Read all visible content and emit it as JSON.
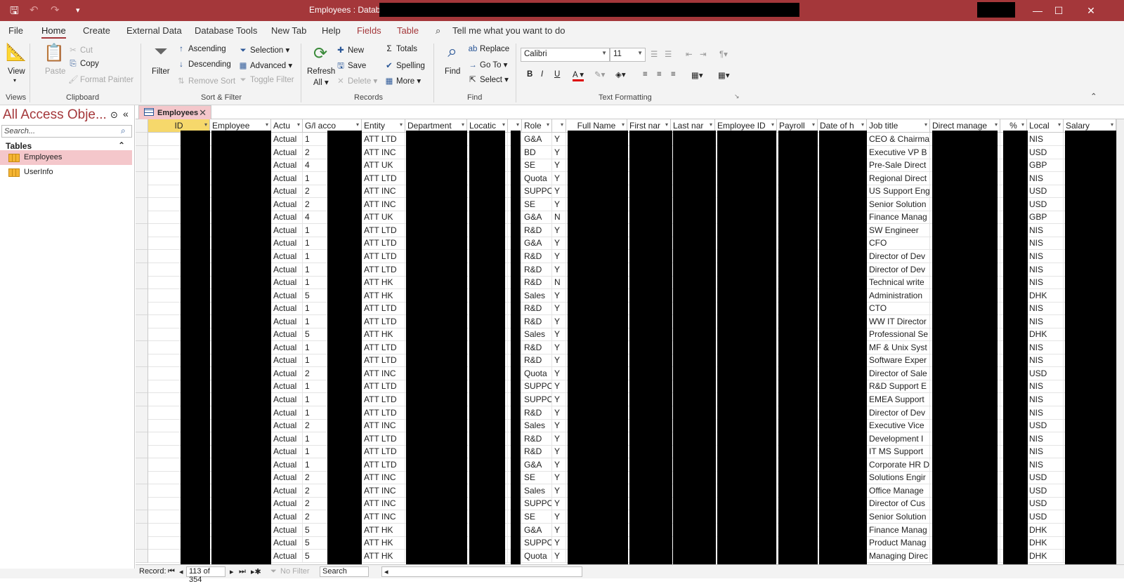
{
  "titlebar": {
    "title": "Employees : Database-"
  },
  "menu": {
    "tabs": [
      "File",
      "Home",
      "Create",
      "External Data",
      "Database Tools",
      "New Tab",
      "Help",
      "Fields",
      "Table"
    ],
    "tell_me": "Tell me what you want to do"
  },
  "ribbon": {
    "views": {
      "view": "View",
      "label": "Views"
    },
    "clipboard": {
      "paste": "Paste",
      "cut": "Cut",
      "copy": "Copy",
      "format_painter": "Format Painter",
      "label": "Clipboard"
    },
    "sort_filter": {
      "filter": "Filter",
      "ascending": "Ascending",
      "descending": "Descending",
      "remove_sort": "Remove Sort",
      "selection": "Selection",
      "advanced": "Advanced",
      "toggle_filter": "Toggle Filter",
      "label": "Sort & Filter"
    },
    "records": {
      "refresh": "Refresh",
      "all": "All",
      "new": "New",
      "save": "Save",
      "delete": "Delete",
      "totals": "Totals",
      "spelling": "Spelling",
      "more": "More",
      "label": "Records"
    },
    "find": {
      "find": "Find",
      "replace": "Replace",
      "goto": "Go To",
      "select": "Select",
      "label": "Find"
    },
    "text": {
      "font": "Calibri",
      "size": "11",
      "bold": "B",
      "italic": "I",
      "underline": "U",
      "label": "Text Formatting"
    }
  },
  "nav": {
    "title": "All Access Obje...",
    "search_placeholder": "Search...",
    "section": "Tables",
    "objects": [
      "Employees",
      "UserInfo"
    ]
  },
  "doc_tab": "Employees",
  "grid": {
    "columns": [
      "ID",
      "Employee",
      "Actu",
      "G/l acco",
      "Entity",
      "Department",
      "Locatic",
      "",
      "Role",
      "",
      "Full Name",
      "First nar",
      "Last nar",
      "Employee ID",
      "Payroll",
      "Date of h",
      "Job title",
      "Direct manage",
      "%",
      "Local",
      "Salary"
    ],
    "rows": [
      [
        "Actual",
        "1",
        "ATT LTD",
        "G&A",
        "Y",
        "CEO & Chairma",
        "NIS"
      ],
      [
        "Actual",
        "2",
        "ATT INC",
        "BD",
        "Y",
        "Executive VP B",
        "USD"
      ],
      [
        "Actual",
        "4",
        "ATT UK",
        "SE",
        "Y",
        "Pre-Sale Direct",
        "GBP"
      ],
      [
        "Actual",
        "1",
        "ATT LTD",
        "Quota",
        "Y",
        "Regional Direct",
        "NIS"
      ],
      [
        "Actual",
        "2",
        "ATT INC",
        "SUPPO",
        "Y",
        "US Support Eng",
        "USD"
      ],
      [
        "Actual",
        "2",
        "ATT INC",
        "SE",
        "Y",
        "Senior Solution",
        "USD"
      ],
      [
        "Actual",
        "4",
        "ATT UK",
        "G&A",
        "N",
        "Finance Manag",
        "GBP"
      ],
      [
        "Actual",
        "1",
        "ATT LTD",
        "R&D",
        "Y",
        "SW Engineer",
        "NIS"
      ],
      [
        "Actual",
        "1",
        "ATT LTD",
        "G&A",
        "Y",
        "CFO",
        "NIS"
      ],
      [
        "Actual",
        "1",
        "ATT LTD",
        "R&D",
        "Y",
        "Director of Dev",
        "NIS"
      ],
      [
        "Actual",
        "1",
        "ATT LTD",
        "R&D",
        "Y",
        "Director of Dev",
        "NIS"
      ],
      [
        "Actual",
        "1",
        "ATT HK",
        "R&D",
        "N",
        "Technical write",
        "NIS"
      ],
      [
        "Actual",
        "5",
        "ATT HK",
        "Sales",
        "Y",
        "Administration",
        "DHK"
      ],
      [
        "Actual",
        "1",
        "ATT LTD",
        "R&D",
        "Y",
        "CTO",
        "NIS"
      ],
      [
        "Actual",
        "1",
        "ATT LTD",
        "R&D",
        "Y",
        "WW IT Director",
        "NIS"
      ],
      [
        "Actual",
        "5",
        "ATT HK",
        "Sales",
        "Y",
        "Professional Se",
        "DHK"
      ],
      [
        "Actual",
        "1",
        "ATT LTD",
        "R&D",
        "Y",
        "MF & Unix Syst",
        "NIS"
      ],
      [
        "Actual",
        "1",
        "ATT LTD",
        "R&D",
        "Y",
        "Software Exper",
        "NIS"
      ],
      [
        "Actual",
        "2",
        "ATT INC",
        "Quota",
        "Y",
        "Director of Sale",
        "USD"
      ],
      [
        "Actual",
        "1",
        "ATT LTD",
        "SUPPO",
        "Y",
        "R&D Support E",
        "NIS"
      ],
      [
        "Actual",
        "1",
        "ATT LTD",
        "SUPPO",
        "Y",
        "EMEA Support",
        "NIS"
      ],
      [
        "Actual",
        "1",
        "ATT LTD",
        "R&D",
        "Y",
        "Director of Dev",
        "NIS"
      ],
      [
        "Actual",
        "2",
        "ATT INC",
        "Sales",
        "Y",
        "Executive Vice",
        "USD"
      ],
      [
        "Actual",
        "1",
        "ATT LTD",
        "R&D",
        "Y",
        "Development I",
        "NIS"
      ],
      [
        "Actual",
        "1",
        "ATT LTD",
        "R&D",
        "Y",
        "IT MS Support",
        "NIS"
      ],
      [
        "Actual",
        "1",
        "ATT LTD",
        "G&A",
        "Y",
        "Corporate HR D",
        "NIS"
      ],
      [
        "Actual",
        "2",
        "ATT INC",
        "SE",
        "Y",
        "Solutions Engir",
        "USD"
      ],
      [
        "Actual",
        "2",
        "ATT INC",
        "Sales",
        "Y",
        "Office Manage",
        "USD"
      ],
      [
        "Actual",
        "2",
        "ATT INC",
        "SUPPO",
        "Y",
        "Director of Cus",
        "USD"
      ],
      [
        "Actual",
        "2",
        "ATT INC",
        "SE",
        "Y",
        "Senior Solution",
        "USD"
      ],
      [
        "Actual",
        "5",
        "ATT HK",
        "G&A",
        "Y",
        "Finance Manag",
        "DHK"
      ],
      [
        "Actual",
        "5",
        "ATT HK",
        "SUPPO",
        "Y",
        "Product Manag",
        "DHK"
      ],
      [
        "Actual",
        "5",
        "ATT HK",
        "Quota",
        "Y",
        "Managing Direc",
        "DHK"
      ]
    ]
  },
  "status": {
    "record_label": "Record:",
    "record_pos": "113 of 354",
    "no_filter": "No Filter",
    "search": "Search"
  }
}
